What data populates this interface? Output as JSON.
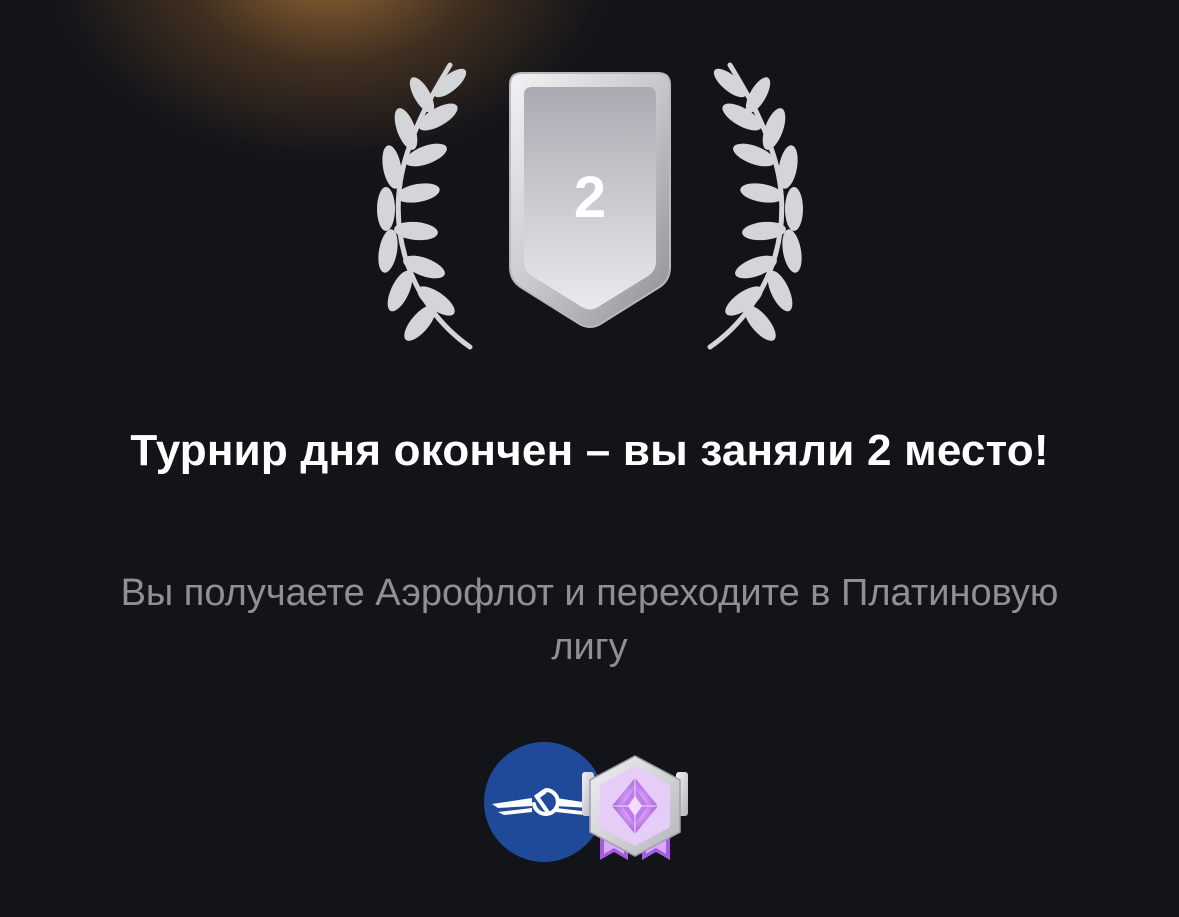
{
  "result": {
    "place": "2",
    "title": "Турнир дня окончен – вы заняли 2 место!",
    "subtitle": "Вы получаете Аэрофлот и переходите в Платиновую лигу"
  },
  "rewards": {
    "airline_icon": "aeroflot-logo-icon",
    "league_icon": "platinum-league-badge-icon"
  },
  "colors": {
    "background": "#121419",
    "glow": "#b0783a",
    "title": "#ffffff",
    "subtitle": "#8e9096",
    "airline_blue": "#1f4a9a",
    "league_purple": "#b36be8"
  }
}
